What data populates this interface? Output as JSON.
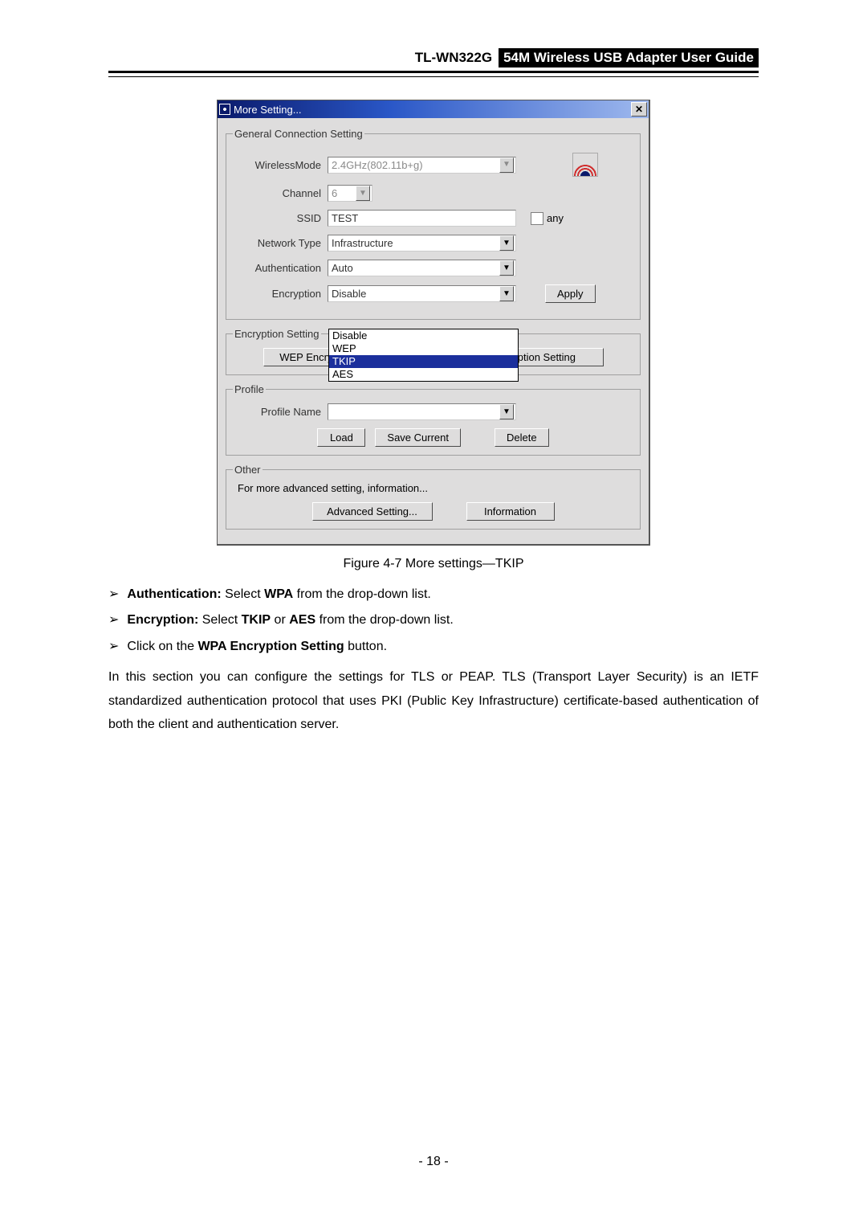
{
  "header": {
    "model": "TL-WN322G",
    "title": "54M Wireless USB Adapter User Guide"
  },
  "dialog": {
    "title": "More Setting...",
    "general_legend": "General Connection Setting",
    "labels": {
      "wireless_mode": "WirelessMode",
      "channel": "Channel",
      "ssid": "SSID",
      "network_type": "Network Type",
      "authentication": "Authentication",
      "encryption": "Encryption",
      "any": "any"
    },
    "values": {
      "wireless_mode": "2.4GHz(802.11b+g)",
      "channel": "6",
      "ssid": "TEST",
      "network_type": "Infrastructure",
      "authentication": "Auto",
      "encryption": "Disable"
    },
    "encryption_options": [
      "Disable",
      "WEP",
      "TKIP",
      "AES"
    ],
    "encryption_selected": "TKIP",
    "apply": "Apply",
    "enc_setting": {
      "legend": "Encryption Setting",
      "wep": "WEP Encryption Key Setting",
      "wpa": "WPA Encryption Setting"
    },
    "profile": {
      "legend": "Profile",
      "name_label": "Profile Name",
      "load": "Load",
      "save": "Save Current",
      "delete": "Delete"
    },
    "other": {
      "legend": "Other",
      "desc": "For more advanced setting, information...",
      "advanced": "Advanced Setting...",
      "information": "Information"
    }
  },
  "caption": "Figure 4-7 More settings—TKIP",
  "bullets": {
    "b1a": "Authentication:",
    "b1b": " Select ",
    "b1c": "WPA",
    "b1d": " from the drop-down list.",
    "b2a": "Encryption:",
    "b2b": " Select ",
    "b2c": "TKIP",
    "b2d": " or ",
    "b2e": "AES",
    "b2f": " from the drop-down list.",
    "b3a": "Click on the ",
    "b3b": "WPA Encryption Setting",
    "b3c": " button."
  },
  "paragraph": "In this section you can configure the settings for TLS or PEAP. TLS (Transport Layer Security) is an IETF standardized authentication protocol that uses PKI (Public Key Infrastructure) certificate-based authentication of both the client and authentication server.",
  "page_num": "- 18 -"
}
